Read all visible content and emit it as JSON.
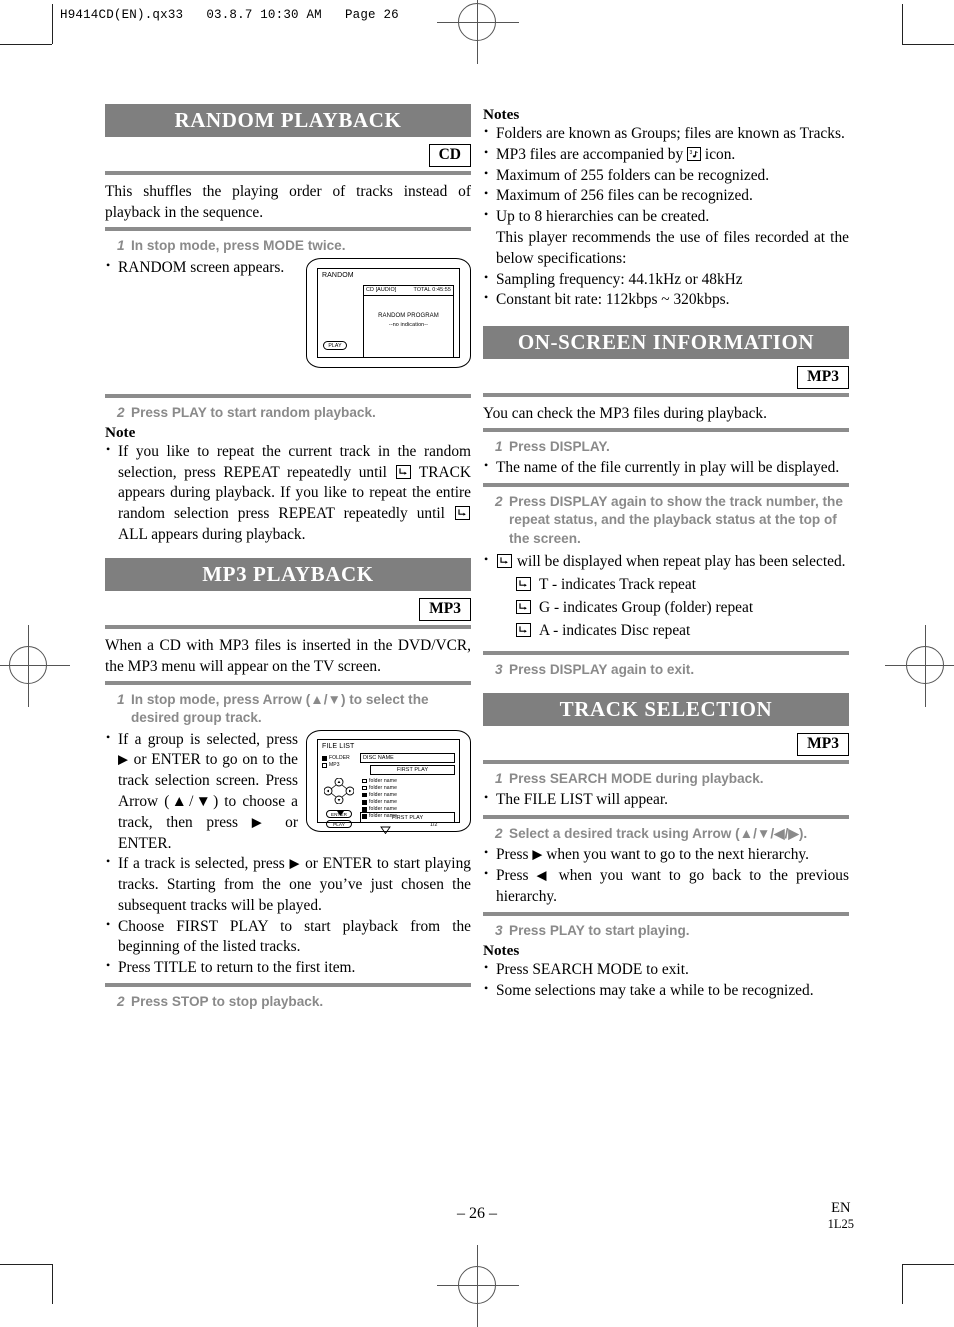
{
  "print_header": "H9414CD(EN).qx33   03.8.7 10:30 AM   Page 26",
  "footer": {
    "page_number": "– 26 –",
    "language": "EN",
    "code": "1L25"
  },
  "left_column": {
    "random_playback": {
      "title": "RANDOM PLAYBACK",
      "badge": "CD",
      "intro": "This shuffles the playing order of tracks instead of playback in the sequence.",
      "step1": {
        "num": "1",
        "text": "In stop mode, press MODE twice."
      },
      "step1_bullet": "RANDOM screen appears.",
      "step2": {
        "num": "2",
        "text": "Press PLAY to start random playback."
      },
      "note_title": "Note",
      "note_bullet_a": "If you like to repeat the current track in the random selection, press REPEAT repeatedly until",
      "note_bullet_b": "TRACK appears during playback. If you like to repeat the entire random selection press REPEAT repeatedly until",
      "note_bullet_c": "ALL appears during playback.",
      "screen": {
        "title": "RANDOM",
        "disc_type": "CD [AUDIO]",
        "total": "TOTAL 0:45:55",
        "program_title": "RANDOM PROGRAM",
        "program_sub": "--no indication--",
        "play_button": "PLAY"
      }
    },
    "mp3_playback": {
      "title": "MP3 PLAYBACK",
      "badge": "MP3",
      "intro": "When a CD with MP3 files is inserted in the DVD/VCR, the MP3 menu will appear on the TV screen.",
      "step1": {
        "num": "1",
        "text": "In stop mode, press Arrow (▲/▼) to select the desired group track."
      },
      "bullet1_a": "If a group is selected, press",
      "bullet1_b": "or ENTER to go on to the track selection screen. Press Arrow (▲/▼) to choose a track, then press",
      "bullet1_c": "or ENTER.",
      "bullet2_a": "If a track is selected, press",
      "bullet2_b": "or ENTER to start playing tracks. Starting from the one you’ve just chosen the subsequent tracks will be played.",
      "bullet3": "Choose FIRST PLAY to start playback from the beginning of the listed tracks.",
      "bullet4": "Press TITLE to return to the first item.",
      "step2": {
        "num": "2",
        "text": "Press STOP to stop playback."
      },
      "screen": {
        "title": "FILE LIST",
        "legend_folder": "FOLDER",
        "legend_mp3": "MP3",
        "disc_name": "DISC NAME",
        "first_play_top": "FIRST PLAY",
        "rows": [
          "folder name",
          "folder name",
          "folder name",
          "folder name",
          "folder name",
          "folder name"
        ],
        "page_indicator": "1/2",
        "enter_button": "ENTER",
        "play_button": "PLAY",
        "first_play_bottom": "FIRST PLAY"
      }
    }
  },
  "right_column": {
    "mp3_notes": {
      "title": "Notes",
      "items": [
        "Folders are known as Groups; files are known as Tracks.",
        "Maximum of 255 folders can be recognized.",
        "Maximum of 256 files can be recognized.",
        "Sampling frequency: 44.1kHz or 48kHz",
        "Constant bit rate: 112kbps ~ 320kbps."
      ],
      "mp3_icon_line_a": "MP3 files are accompanied by",
      "mp3_icon_line_b": "icon.",
      "hierarchy_line": "Up to 8 hierarchies can be created.",
      "hierarchy_sub": "This player recommends the use of files recorded at the below specifications:"
    },
    "on_screen_information": {
      "title": "ON-SCREEN INFORMATION",
      "badge": "MP3",
      "intro": "You can check the MP3 files during playback.",
      "step1": {
        "num": "1",
        "text": "Press DISPLAY."
      },
      "step1_bullet": "The name of the file currently in play will be displayed.",
      "step2": {
        "num": "2",
        "text": "Press DISPLAY again to show the track number, the repeat status, and the playback status at the top of the screen."
      },
      "repeat_bullet": "will be displayed when repeat play has been selected.",
      "repeat_modes": [
        "T - indicates Track repeat",
        "G - indicates Group (folder) repeat",
        "A - indicates Disc repeat"
      ],
      "step3": {
        "num": "3",
        "text": "Press DISPLAY again to exit."
      }
    },
    "track_selection": {
      "title": "TRACK SELECTION",
      "badge": "MP3",
      "step1": {
        "num": "1",
        "text": "Press SEARCH MODE during playback."
      },
      "step1_bullet": "The FILE LIST will appear.",
      "step2": {
        "num": "2",
        "text": "Select a desired track using Arrow (▲/▼/◀/▶)."
      },
      "step2_bullet_a": "Press",
      "step2_bullet_a_rest": "when you want to go to the next hierarchy.",
      "step2_bullet_b": "Press",
      "step2_bullet_b_rest": "when you want to go back to the previous hierarchy.",
      "step3": {
        "num": "3",
        "text": "Press PLAY to start playing."
      },
      "notes_title": "Notes",
      "notes": [
        "Press SEARCH MODE to exit.",
        "Some selections may take a while to be recognized."
      ]
    }
  },
  "colors": {
    "section_header_bg": "#7f7f7f",
    "rule": "#8c8c8c",
    "step_text": "#8a8a8a"
  }
}
